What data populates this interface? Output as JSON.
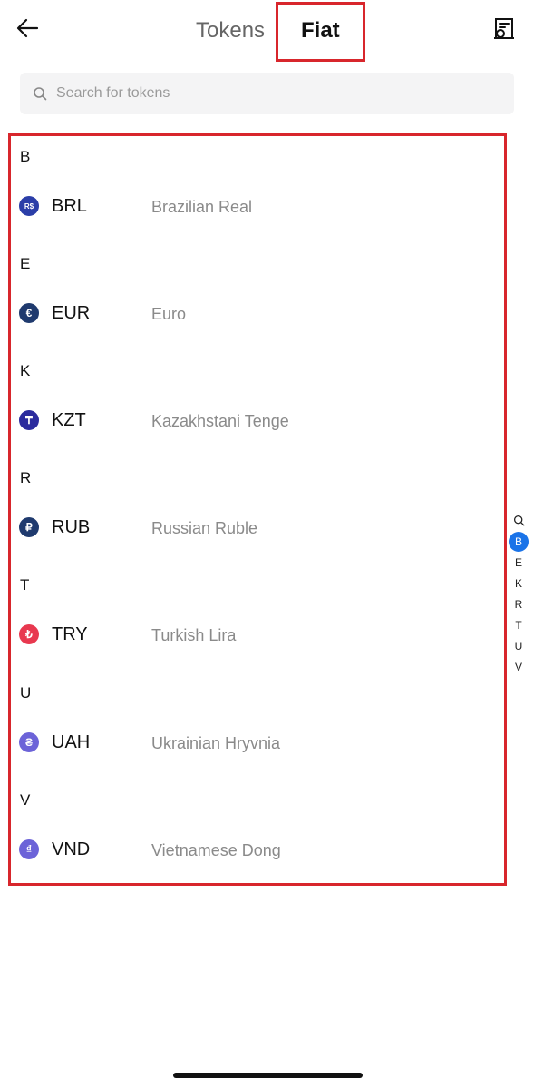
{
  "header": {
    "tabs": [
      {
        "label": "Tokens",
        "active": false
      },
      {
        "label": "Fiat",
        "active": true
      }
    ]
  },
  "search": {
    "placeholder": "Search for tokens",
    "value": ""
  },
  "sections": [
    {
      "letter": "B",
      "items": [
        {
          "code": "BRL",
          "name": "Brazilian Real",
          "icon_symbol": "R$",
          "icon_color": "#2b3ea8"
        }
      ]
    },
    {
      "letter": "E",
      "items": [
        {
          "code": "EUR",
          "name": "Euro",
          "icon_symbol": "€",
          "icon_color": "#1f3a6e"
        }
      ]
    },
    {
      "letter": "K",
      "items": [
        {
          "code": "KZT",
          "name": "Kazakhstani Tenge",
          "icon_symbol": "₸",
          "icon_color": "#2b2b9e"
        }
      ]
    },
    {
      "letter": "R",
      "items": [
        {
          "code": "RUB",
          "name": "Russian Ruble",
          "icon_symbol": "₽",
          "icon_color": "#1f3a6e"
        }
      ]
    },
    {
      "letter": "T",
      "items": [
        {
          "code": "TRY",
          "name": "Turkish Lira",
          "icon_symbol": "₺",
          "icon_color": "#e8384f"
        }
      ]
    },
    {
      "letter": "U",
      "items": [
        {
          "code": "UAH",
          "name": "Ukrainian Hryvnia",
          "icon_symbol": "₴",
          "icon_color": "#6c63d8"
        }
      ]
    },
    {
      "letter": "V",
      "items": [
        {
          "code": "VND",
          "name": "Vietnamese Dong",
          "icon_symbol": "₫",
          "icon_color": "#6c63d8"
        }
      ]
    }
  ],
  "index_bar": {
    "letters": [
      "B",
      "E",
      "K",
      "R",
      "T",
      "U",
      "V"
    ],
    "selected": "B",
    "search_icon": "search-icon",
    "accent": "#1a73e8"
  },
  "colors": {
    "highlight": "#d8262c"
  }
}
